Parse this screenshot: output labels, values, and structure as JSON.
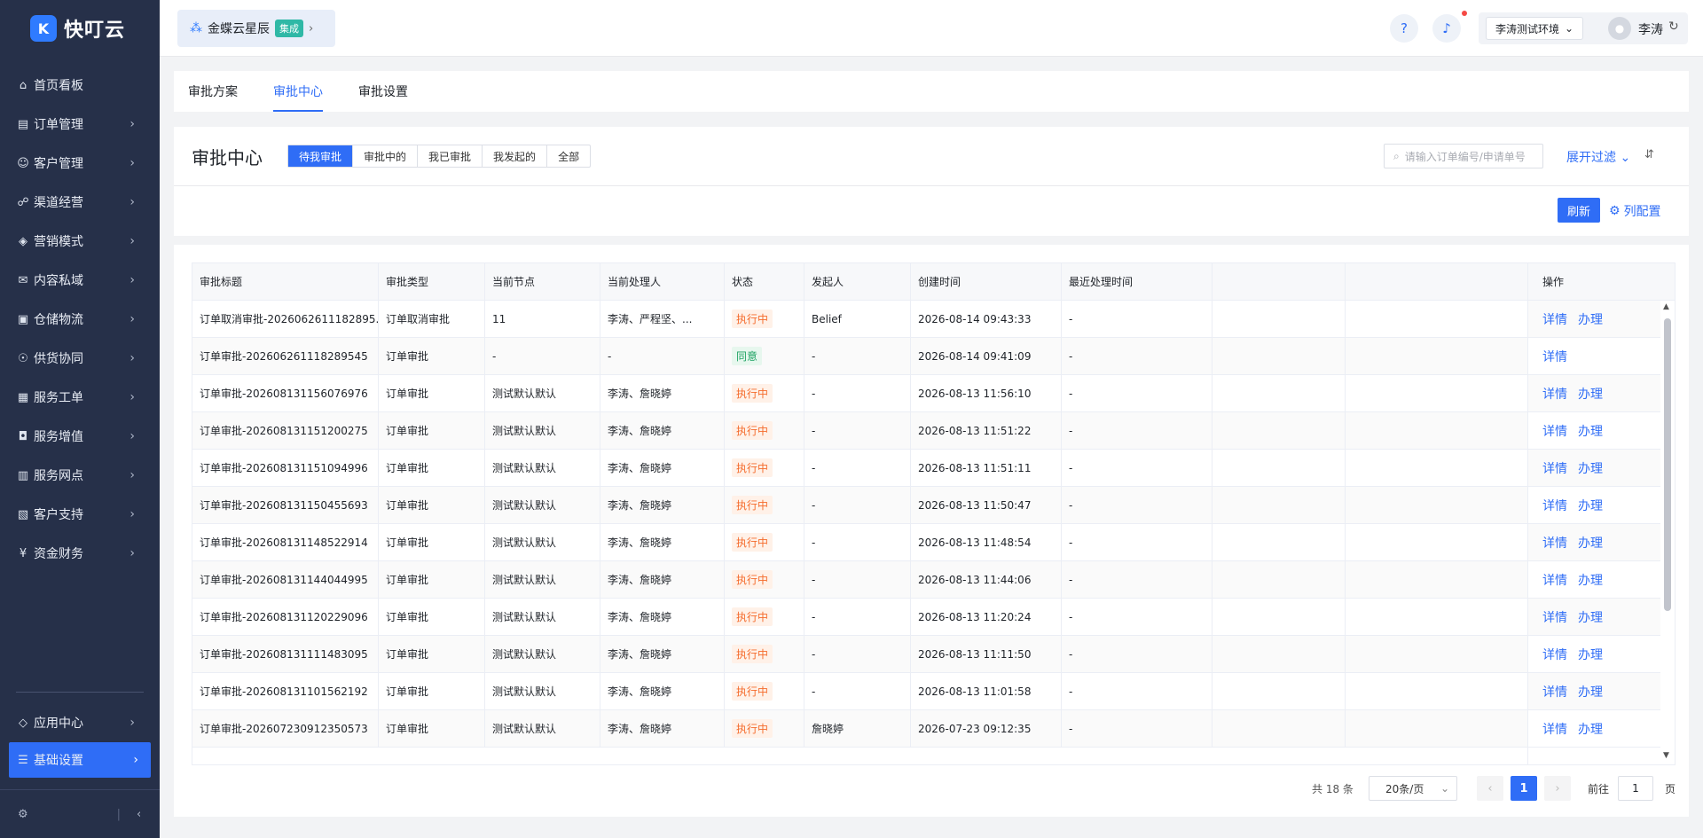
{
  "brand": {
    "logo_mark": "K",
    "name": "快叮云"
  },
  "integration": {
    "name": "金蝶云星辰",
    "tag": "集成"
  },
  "header": {
    "env": "李涛测试环境",
    "user": "李涛"
  },
  "nav": [
    {
      "label": "首页看板",
      "icon": "home-icon",
      "glyph": "⌂",
      "chev": false
    },
    {
      "label": "订单管理",
      "icon": "order-icon",
      "glyph": "▤",
      "chev": true
    },
    {
      "label": "客户管理",
      "icon": "customer-icon",
      "glyph": "☺",
      "chev": true
    },
    {
      "label": "渠道经营",
      "icon": "channel-icon",
      "glyph": "☍",
      "chev": true
    },
    {
      "label": "营销模式",
      "icon": "marketing-icon",
      "glyph": "◈",
      "chev": true
    },
    {
      "label": "内容私域",
      "icon": "content-icon",
      "glyph": "✉",
      "chev": true
    },
    {
      "label": "仓储物流",
      "icon": "warehouse-icon",
      "glyph": "▣",
      "chev": true
    },
    {
      "label": "供货协同",
      "icon": "supply-icon",
      "glyph": "☉",
      "chev": true
    },
    {
      "label": "服务工单",
      "icon": "ticket-icon",
      "glyph": "▦",
      "chev": true
    },
    {
      "label": "服务增值",
      "icon": "value-icon",
      "glyph": "◘",
      "chev": true
    },
    {
      "label": "服务网点",
      "icon": "outlet-icon",
      "glyph": "▥",
      "chev": true
    },
    {
      "label": "客户支持",
      "icon": "support-icon",
      "glyph": "▧",
      "chev": true
    },
    {
      "label": "资金财务",
      "icon": "finance-icon",
      "glyph": "¥",
      "chev": true
    }
  ],
  "nav_bottom": [
    {
      "label": "应用中心",
      "icon": "app-center-icon",
      "glyph": "◇"
    },
    {
      "label": "基础设置",
      "icon": "settings-icon",
      "glyph": "☰"
    }
  ],
  "tabs": [
    "审批方案",
    "审批中心",
    "审批设置"
  ],
  "page": {
    "title": "审批中心",
    "filters": [
      "待我审批",
      "审批中的",
      "我已审批",
      "我发起的",
      "全部"
    ],
    "search_placeholder": "请输入订单编号/申请单号",
    "expand_label": "展开过滤",
    "refresh_label": "刷新",
    "colcfg_label": "列配置"
  },
  "table": {
    "headers": [
      "审批标题",
      "审批类型",
      "当前节点",
      "当前处理人",
      "状态",
      "发起人",
      "创建时间",
      "最近处理时间"
    ],
    "action_header": "操作",
    "rows": [
      {
        "title": "订单取消审批-2026062611182895...",
        "type": "订单取消审批",
        "node": "11",
        "handler": "李涛、严程坚、...",
        "status": "执行中",
        "status_kind": "run",
        "initiator": "Belief",
        "created": "2026-08-14 09:43:33",
        "last": "-",
        "actions": [
          "详情",
          "办理"
        ]
      },
      {
        "title": "订单审批-202606261118289545",
        "type": "订单审批",
        "node": "-",
        "handler": "-",
        "status": "同意",
        "status_kind": "ok",
        "initiator": "-",
        "created": "2026-08-14 09:41:09",
        "last": "-",
        "actions": [
          "详情"
        ]
      },
      {
        "title": "订单审批-202608131156076976",
        "type": "订单审批",
        "node": "测试默认默认",
        "handler": "李涛、詹晓婷",
        "status": "执行中",
        "status_kind": "run",
        "initiator": "-",
        "created": "2026-08-13 11:56:10",
        "last": "-",
        "actions": [
          "详情",
          "办理"
        ]
      },
      {
        "title": "订单审批-202608131151200275",
        "type": "订单审批",
        "node": "测试默认默认",
        "handler": "李涛、詹晓婷",
        "status": "执行中",
        "status_kind": "run",
        "initiator": "-",
        "created": "2026-08-13 11:51:22",
        "last": "-",
        "actions": [
          "详情",
          "办理"
        ]
      },
      {
        "title": "订单审批-202608131151094996",
        "type": "订单审批",
        "node": "测试默认默认",
        "handler": "李涛、詹晓婷",
        "status": "执行中",
        "status_kind": "run",
        "initiator": "-",
        "created": "2026-08-13 11:51:11",
        "last": "-",
        "actions": [
          "详情",
          "办理"
        ]
      },
      {
        "title": "订单审批-202608131150455693",
        "type": "订单审批",
        "node": "测试默认默认",
        "handler": "李涛、詹晓婷",
        "status": "执行中",
        "status_kind": "run",
        "initiator": "-",
        "created": "2026-08-13 11:50:47",
        "last": "-",
        "actions": [
          "详情",
          "办理"
        ]
      },
      {
        "title": "订单审批-202608131148522914",
        "type": "订单审批",
        "node": "测试默认默认",
        "handler": "李涛、詹晓婷",
        "status": "执行中",
        "status_kind": "run",
        "initiator": "-",
        "created": "2026-08-13 11:48:54",
        "last": "-",
        "actions": [
          "详情",
          "办理"
        ]
      },
      {
        "title": "订单审批-202608131144044995",
        "type": "订单审批",
        "node": "测试默认默认",
        "handler": "李涛、詹晓婷",
        "status": "执行中",
        "status_kind": "run",
        "initiator": "-",
        "created": "2026-08-13 11:44:06",
        "last": "-",
        "actions": [
          "详情",
          "办理"
        ]
      },
      {
        "title": "订单审批-202608131120229096",
        "type": "订单审批",
        "node": "测试默认默认",
        "handler": "李涛、詹晓婷",
        "status": "执行中",
        "status_kind": "run",
        "initiator": "-",
        "created": "2026-08-13 11:20:24",
        "last": "-",
        "actions": [
          "详情",
          "办理"
        ]
      },
      {
        "title": "订单审批-202608131111483095",
        "type": "订单审批",
        "node": "测试默认默认",
        "handler": "李涛、詹晓婷",
        "status": "执行中",
        "status_kind": "run",
        "initiator": "-",
        "created": "2026-08-13 11:11:50",
        "last": "-",
        "actions": [
          "详情",
          "办理"
        ]
      },
      {
        "title": "订单审批-202608131101562192",
        "type": "订单审批",
        "node": "测试默认默认",
        "handler": "李涛、詹晓婷",
        "status": "执行中",
        "status_kind": "run",
        "initiator": "-",
        "created": "2026-08-13 11:01:58",
        "last": "-",
        "actions": [
          "详情",
          "办理"
        ]
      },
      {
        "title": "订单审批-202607230912350573",
        "type": "订单审批",
        "node": "测试默认默认",
        "handler": "李涛、詹晓婷",
        "status": "执行中",
        "status_kind": "run",
        "initiator": "詹晓婷",
        "created": "2026-07-23 09:12:35",
        "last": "-",
        "actions": [
          "详情",
          "办理"
        ]
      }
    ]
  },
  "pager": {
    "total": "共 18 条",
    "page_size": "20条/页",
    "current": "1",
    "goto": "前往",
    "goto_value": "1",
    "page_unit": "页"
  }
}
